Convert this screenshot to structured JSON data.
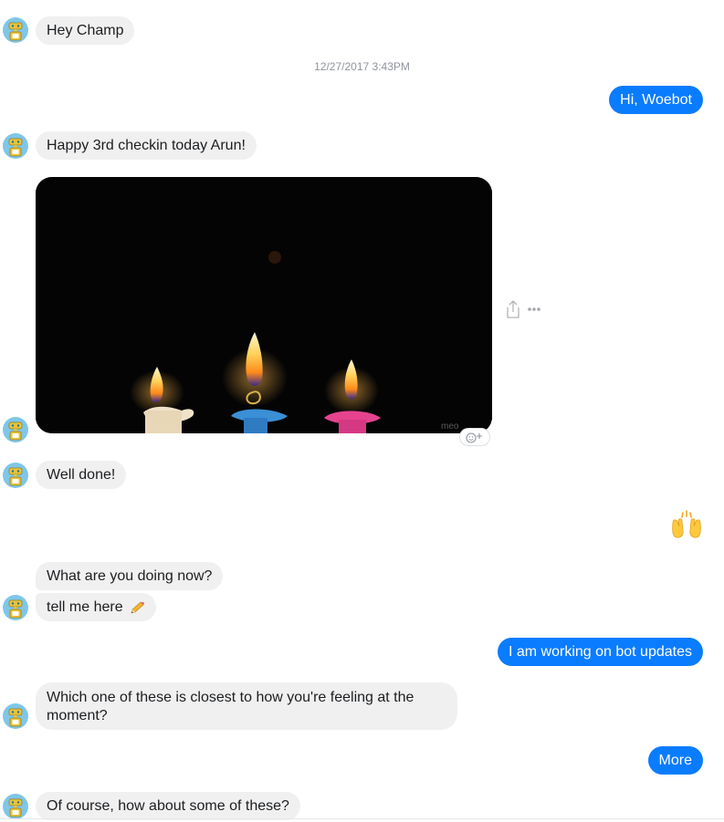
{
  "conversation": {
    "timestamp": "12/27/2017 3:43PM",
    "messages": {
      "m1": "Hey Champ",
      "m2": "Hi, Woebot",
      "m3": "Happy 3rd checkin today Arun!",
      "m4": "Well done!",
      "m5_emoji": "raising-hands",
      "m6": "What are you doing now?",
      "m7": "tell me here",
      "m8": "I am working on bot updates",
      "m9": "Which one of these is closest to how you're feeling at the moment?",
      "m10": "More",
      "m11": "Of course, how about some of these?"
    },
    "media": {
      "watermark": "meo",
      "icon": "candles-gif"
    }
  },
  "colors": {
    "outgoing": "#0a7cff",
    "incoming": "#f0f0f0",
    "timestamp": "#90949c"
  },
  "icons": [
    "robot-avatar-icon",
    "share-icon",
    "more-options-icon",
    "add-reaction-icon",
    "pencil-icon",
    "raising-hands-icon"
  ]
}
